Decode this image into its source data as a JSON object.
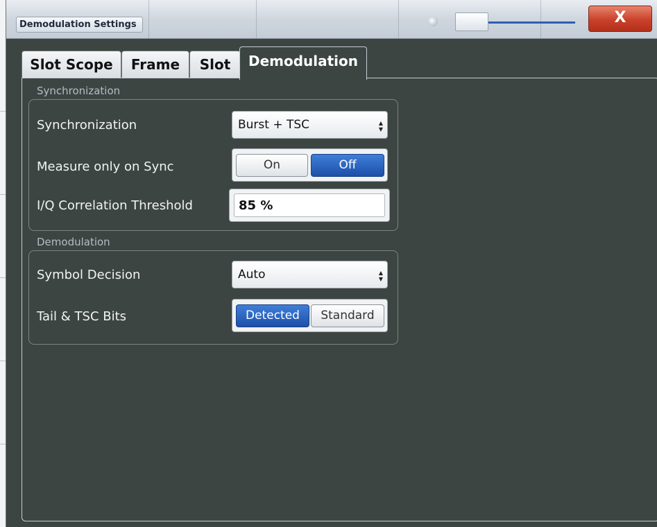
{
  "window": {
    "title": "Demodulation Settings",
    "close_label": "X"
  },
  "tabs": [
    {
      "label": "Slot Scope",
      "active": false
    },
    {
      "label": "Frame",
      "active": false
    },
    {
      "label": "Slot",
      "active": false
    },
    {
      "label": "Demodulation",
      "active": true
    }
  ],
  "synchronization": {
    "section_title": "Synchronization",
    "sync_label": "Synchronization",
    "sync_value": "Burst + TSC",
    "measure_label": "Measure only on Sync",
    "measure_on_label": "On",
    "measure_off_label": "Off",
    "measure_selected": "Off",
    "iq_label": "I/Q Correlation Threshold",
    "iq_value": "85 %"
  },
  "demodulation": {
    "section_title": "Demodulation",
    "symbol_label": "Symbol Decision",
    "symbol_value": "Auto",
    "tail_label": "Tail & TSC Bits",
    "tail_detected_label": "Detected",
    "tail_standard_label": "Standard",
    "tail_selected": "Detected"
  },
  "colors": {
    "panel_bg": "#3d4543",
    "accent_blue": "#1d4fa8",
    "close_red": "#c9412a"
  }
}
